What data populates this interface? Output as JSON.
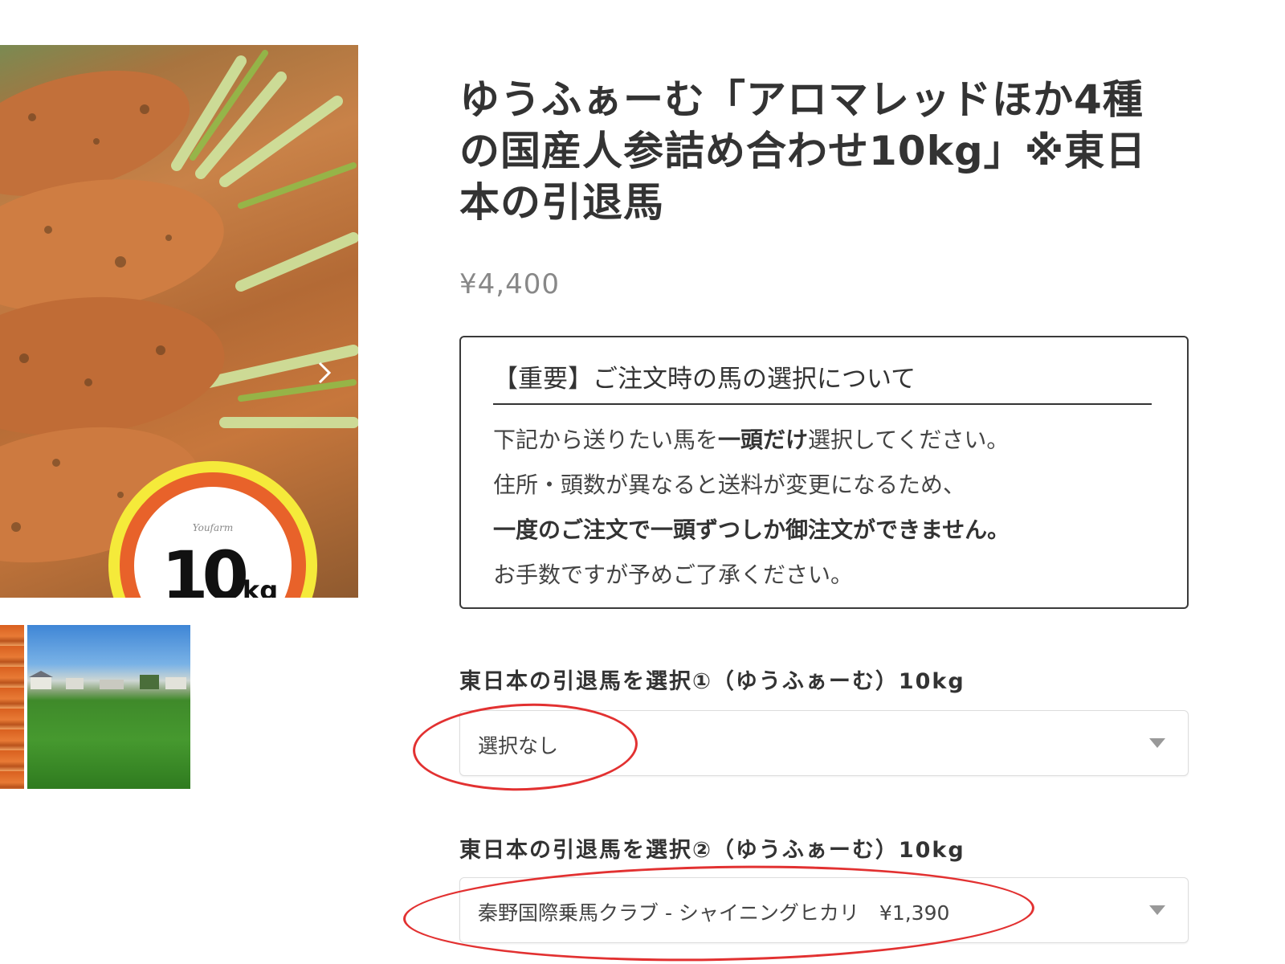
{
  "gallery": {
    "badge_brand": "Youfarm",
    "badge_weight_number": "10",
    "badge_weight_unit": "kg",
    "next_icon": "chevron-right-icon"
  },
  "product": {
    "title": "ゆうふぁーむ「アロマレッドほか4種の国産人参詰め合わせ10kg」※東日本の引退馬",
    "price": "¥4,400"
  },
  "notice": {
    "heading": "【重要】ご注文時の馬の選択について",
    "line1_pre": "下記から送りたい馬を",
    "line1_bold": "一頭だけ",
    "line1_post": "選択してください。",
    "line2": "住所・頭数が異なると送料が変更になるため、",
    "line3": "一度のご注文で一頭ずつしか御注文ができません。",
    "line4": "お手数ですが予めご了承ください。"
  },
  "options": [
    {
      "label": "東日本の引退馬を選択①（ゆうふぁーむ）10kg",
      "selected": "選択なし"
    },
    {
      "label": "東日本の引退馬を選択②（ゆうふぁーむ）10kg",
      "selected": "秦野国際乗馬クラブ - シャイニングヒカリ　¥1,390"
    }
  ],
  "colors": {
    "annotation": "#e23131",
    "badge_yellow": "#f5ea3a",
    "badge_orange": "#e8622a"
  }
}
